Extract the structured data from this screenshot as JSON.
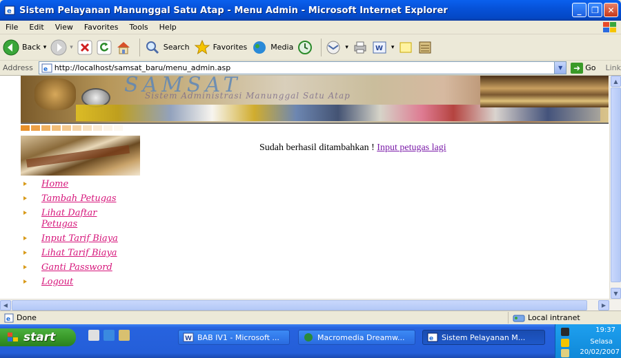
{
  "window": {
    "title": "Sistem Pelayanan Manunggal Satu Atap - Menu Admin - Microsoft Internet Explorer",
    "min_label": "_",
    "max_label": "❐",
    "close_label": "✕"
  },
  "menubar": {
    "items": [
      "File",
      "Edit",
      "View",
      "Favorites",
      "Tools",
      "Help"
    ]
  },
  "toolbar": {
    "back": "Back",
    "search": "Search",
    "favorites": "Favorites",
    "media": "Media",
    "back_dropdown": "▾",
    "forward_dropdown": "▾",
    "mail_dropdown": "▾",
    "word_dropdown": "▾"
  },
  "address": {
    "label": "Address",
    "url": "http://localhost/samsat_baru/menu_admin.asp",
    "go": "Go",
    "links": "Link"
  },
  "banner": {
    "brand": "SAMSAT",
    "subtitle": "Sistem Administrasi Manunggal Satu Atap"
  },
  "nav": {
    "items": [
      "Home",
      "Tambah Petugas",
      "Lihat Daftar Petugas",
      "Input Tarif Biaya",
      "Lihat Tarif Biaya",
      "Ganti Password",
      "Logout"
    ]
  },
  "main": {
    "message": "Sudah berhasil ditambahkan ! ",
    "link": "Input petugas lagi"
  },
  "statusbar": {
    "status": "Done",
    "zone": "Local intranet"
  },
  "taskbar": {
    "start": "start",
    "buttons": [
      "BAB IV1 - Microsoft ...",
      "Macromedia Dreamw...",
      "Sistem Pelayanan M..."
    ],
    "clock_time": "19:37",
    "clock_day": "Selasa",
    "clock_date": "20/02/2007"
  },
  "colors": {
    "link_pink": "#d6147a",
    "link_visited": "#7a1aa8",
    "bullet": "#d89a1a",
    "xp_blue": "#245ed8"
  }
}
